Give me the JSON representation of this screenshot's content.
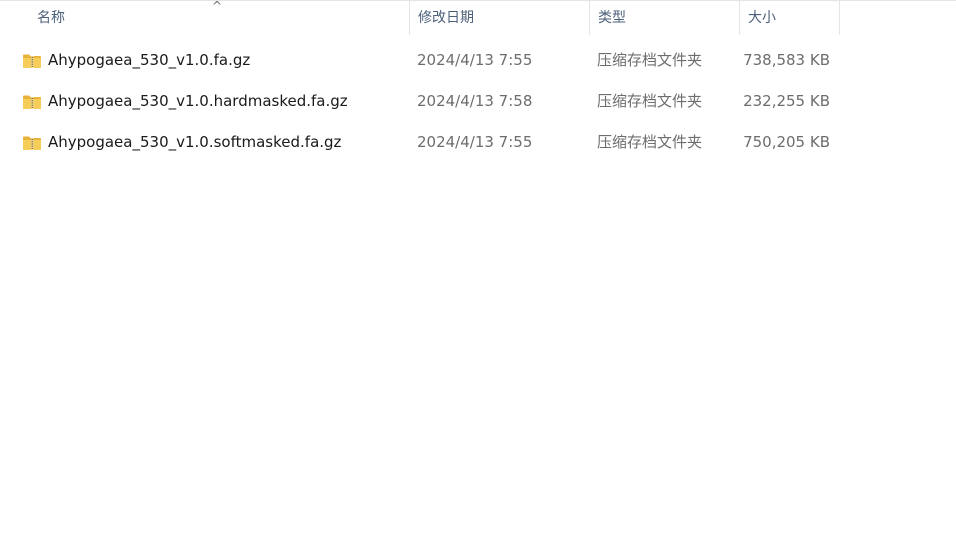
{
  "columns": {
    "name": "名称",
    "date": "修改日期",
    "type": "类型",
    "size": "大小"
  },
  "sort_indicator": "^",
  "files": [
    {
      "icon": "zip-folder-icon",
      "name": "Ahypogaea_530_v1.0.fa.gz",
      "date": "2024/4/13 7:55",
      "type": "压缩存档文件夹",
      "size": "738,583 KB"
    },
    {
      "icon": "zip-folder-icon",
      "name": "Ahypogaea_530_v1.0.hardmasked.fa.gz",
      "date": "2024/4/13 7:58",
      "type": "压缩存档文件夹",
      "size": "232,255 KB"
    },
    {
      "icon": "zip-folder-icon",
      "name": "Ahypogaea_530_v1.0.softmasked.fa.gz",
      "date": "2024/4/13 7:55",
      "type": "压缩存档文件夹",
      "size": "750,205 KB"
    }
  ],
  "colors": {
    "header_text": "#4c607a",
    "folder_yellow": "#f5c342",
    "zipper": "#8a6d1e"
  }
}
